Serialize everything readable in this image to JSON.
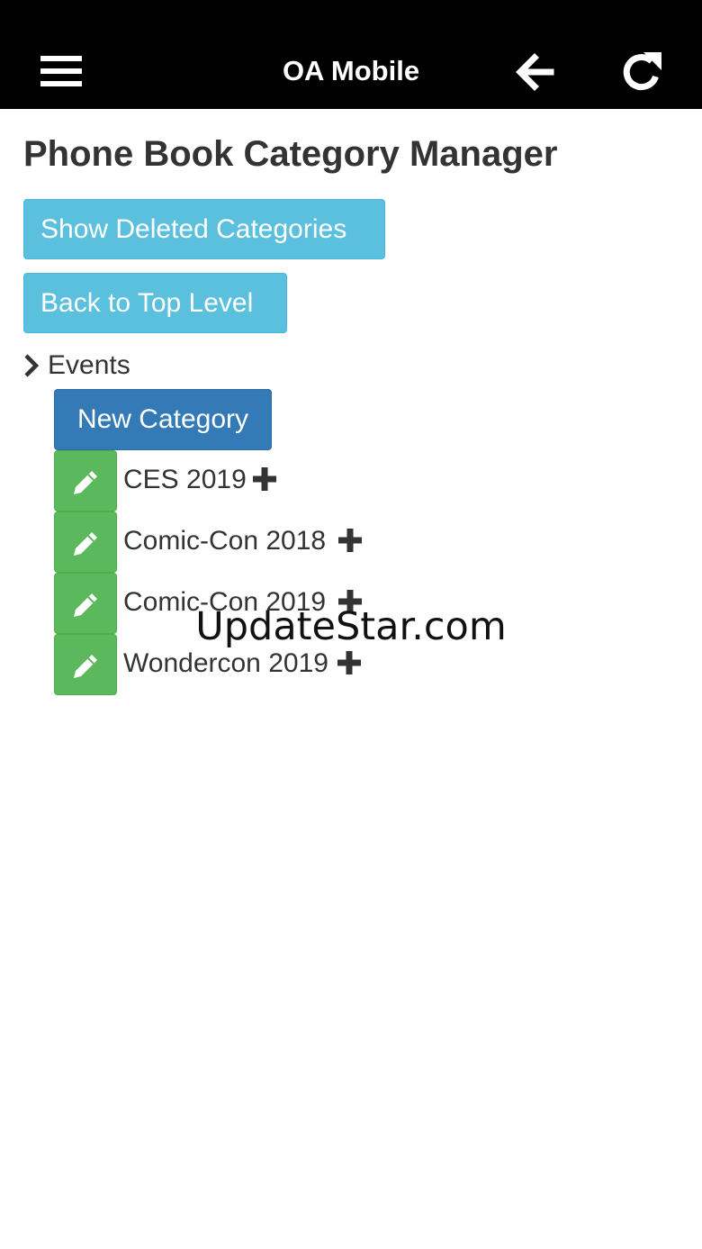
{
  "header": {
    "title": "OA Mobile",
    "menu_icon": "hamburger-menu-icon",
    "back_icon": "arrow-left-icon",
    "refresh_icon": "refresh-icon",
    "background_color": "#000000",
    "text_color": "#ffffff"
  },
  "page": {
    "title": "Phone Book Category Manager"
  },
  "actions": {
    "show_deleted_label": "Show Deleted Categories",
    "back_to_top_label": "Back to Top Level",
    "info_button_color": "#5bc0de"
  },
  "tree": {
    "root_label": "Events",
    "root_icon": "chevron-right-icon",
    "new_category_label": "New Category",
    "new_category_color": "#337ab7",
    "edit_button_color": "#5cb85c",
    "categories": [
      {
        "name": "CES 2019",
        "edit_icon": "pencil-icon",
        "add_icon": "plus-icon"
      },
      {
        "name": "Comic-Con 2018",
        "edit_icon": "pencil-icon",
        "add_icon": "plus-icon"
      },
      {
        "name": "Comic-Con 2019",
        "edit_icon": "pencil-icon",
        "add_icon": "plus-icon"
      },
      {
        "name": "Wondercon 2019",
        "edit_icon": "pencil-icon",
        "add_icon": "plus-icon"
      }
    ]
  },
  "watermark": {
    "text": "UpdateStar.com"
  }
}
